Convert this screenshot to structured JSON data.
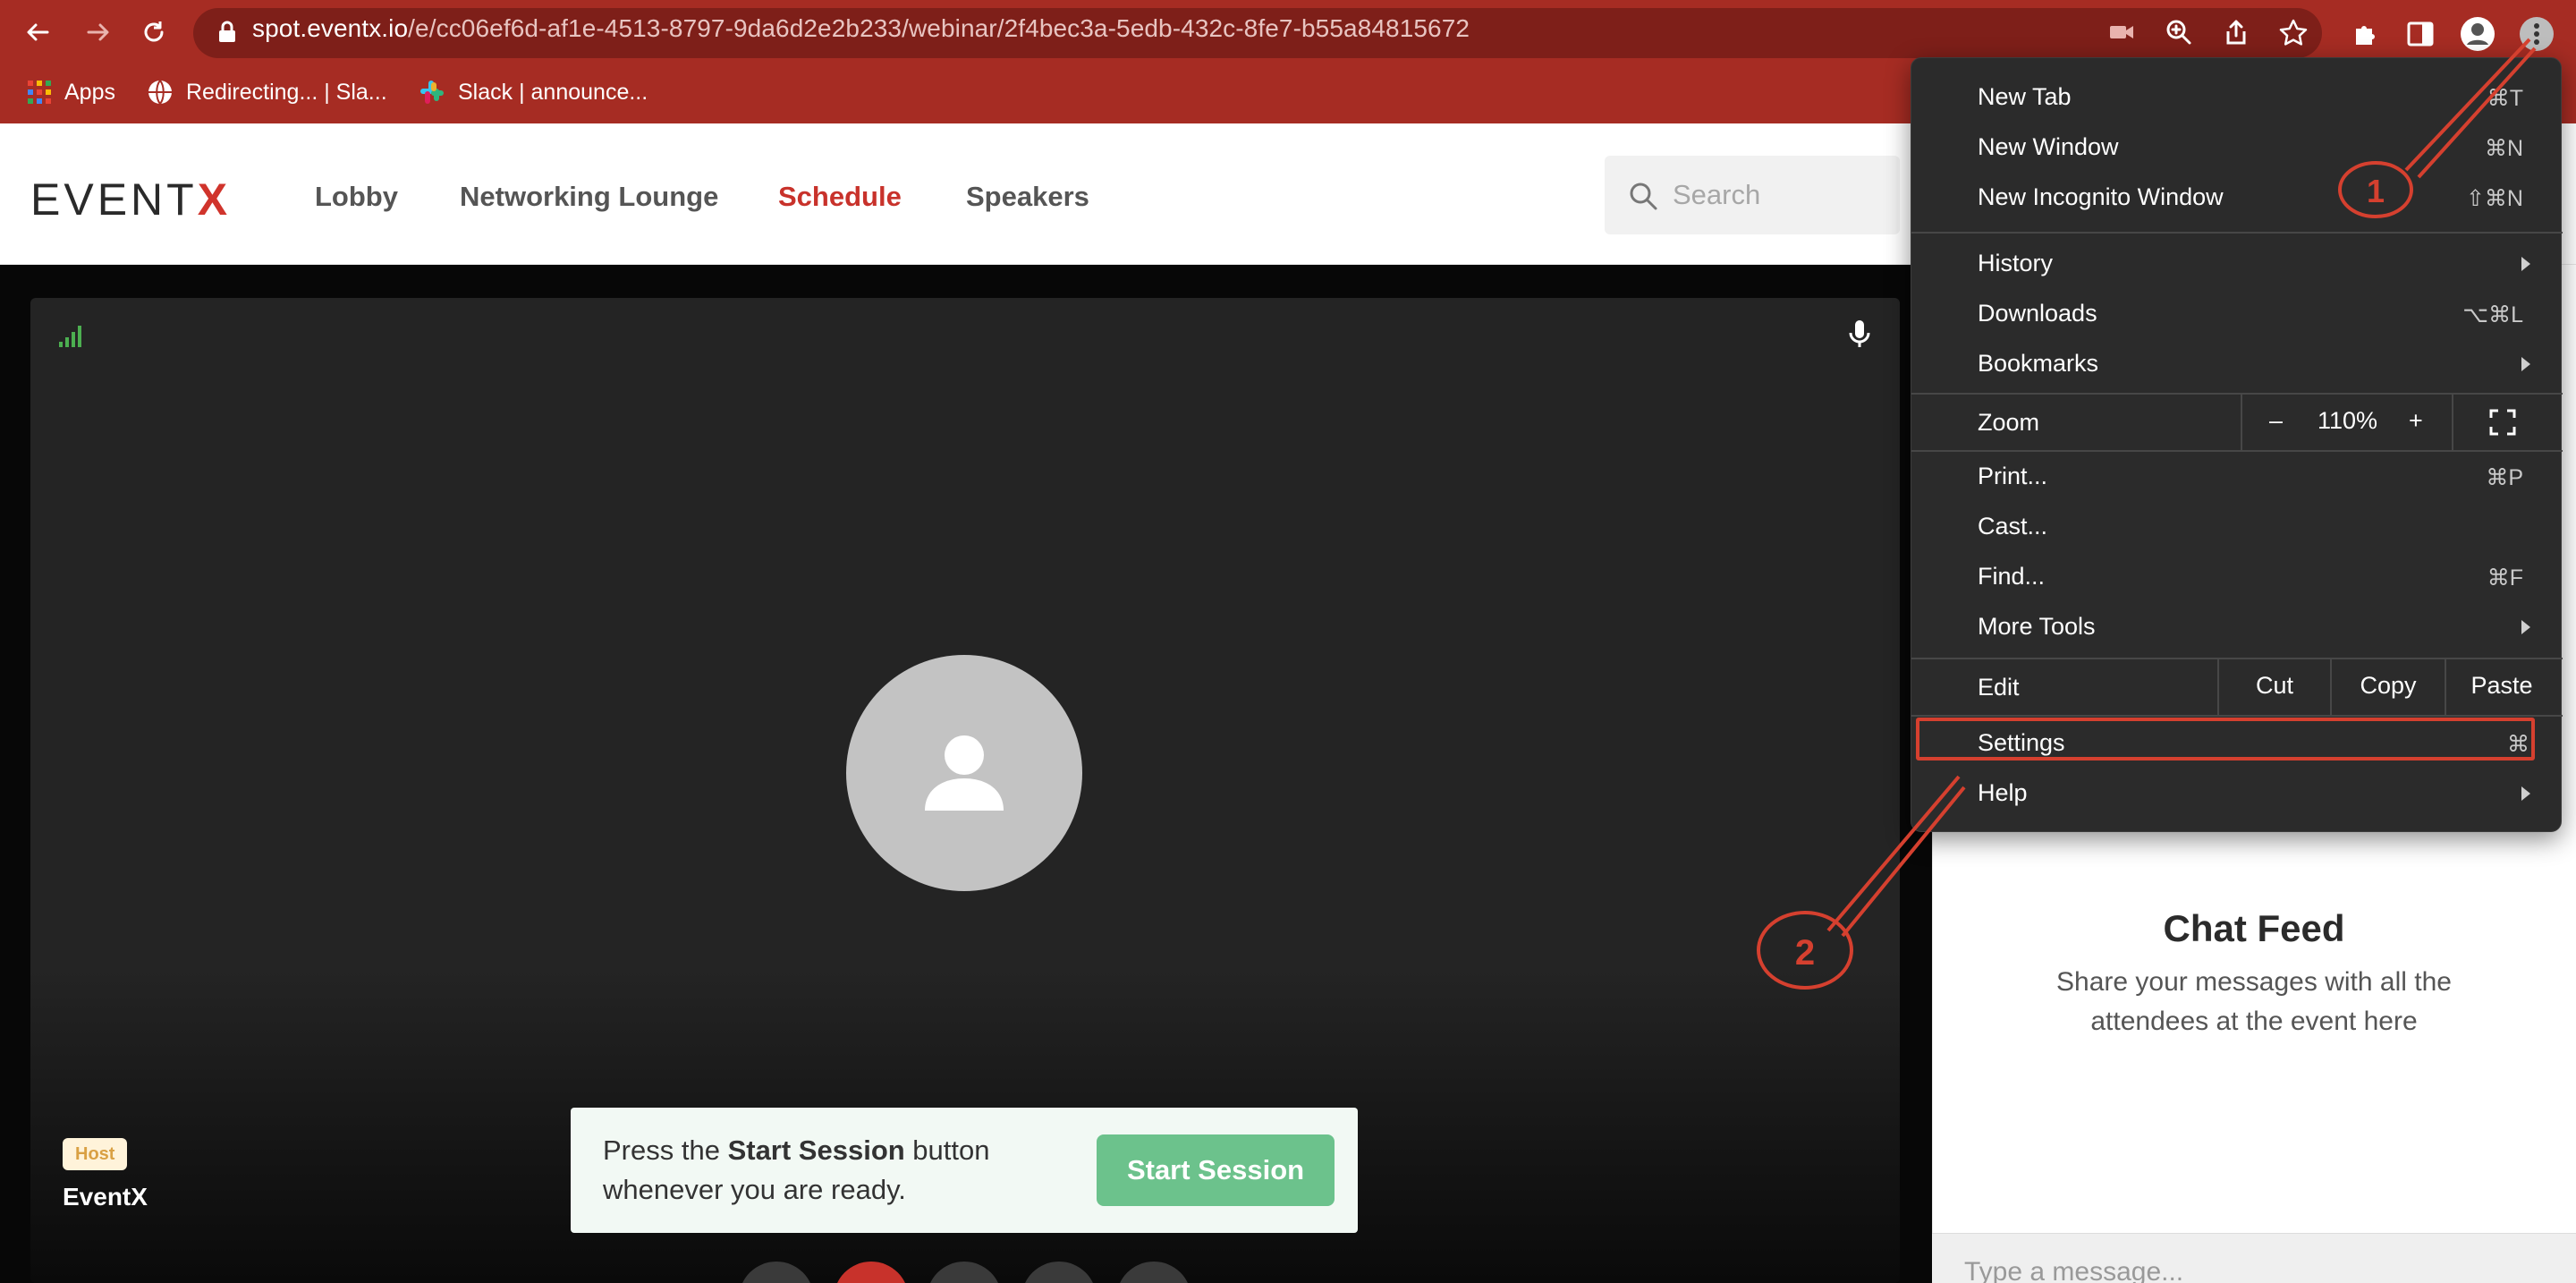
{
  "browser": {
    "url_host": "spot.eventx.io",
    "url_path": "/e/cc06ef6d-af1e-4513-8797-9da6d2e2b233/webinar/2f4bec3a-5edb-432c-8fe7-b55a84815672",
    "bookmarks": [
      "Apps",
      "Redirecting... | Sla...",
      "Slack | announce..."
    ]
  },
  "site": {
    "logo_main": "EVENT",
    "logo_accent": "X",
    "nav": [
      "Lobby",
      "Networking Lounge",
      "Schedule",
      "Speakers"
    ],
    "search_placeholder": "Search"
  },
  "stage": {
    "host_badge": "Host",
    "host_name": "EventX",
    "session_prompt_pre": "Press the ",
    "session_prompt_bold": "Start Session",
    "session_prompt_post": " button whenever you are ready.",
    "start_button": "Start Session"
  },
  "chat": {
    "title": "Chat Feed",
    "subtitle": "Share your messages with all the attendees at the event here",
    "placeholder": "Type a message..."
  },
  "menu": {
    "new_tab": "New Tab",
    "new_tab_sc": "⌘T",
    "new_window": "New Window",
    "new_window_sc": "⌘N",
    "new_incognito": "New Incognito Window",
    "new_incognito_sc": "⇧⌘N",
    "history": "History",
    "downloads": "Downloads",
    "downloads_sc": "⌥⌘L",
    "bookmarks": "Bookmarks",
    "zoom": "Zoom",
    "zoom_minus": "–",
    "zoom_value": "110%",
    "zoom_plus": "+",
    "print": "Print...",
    "print_sc": "⌘P",
    "cast": "Cast...",
    "find": "Find...",
    "find_sc": "⌘F",
    "more_tools": "More Tools",
    "edit": "Edit",
    "cut": "Cut",
    "copy": "Copy",
    "paste": "Paste",
    "settings": "Settings",
    "settings_sc": "⌘,",
    "help": "Help"
  },
  "annotations": {
    "step1": "1",
    "step2": "2"
  },
  "colors": {
    "chrome_bar": "#a62c23",
    "accent_red": "#c8322b",
    "start_green": "#6cc28c",
    "annotation_red": "#d5402f",
    "menu_bg": "#2b2b2b"
  }
}
